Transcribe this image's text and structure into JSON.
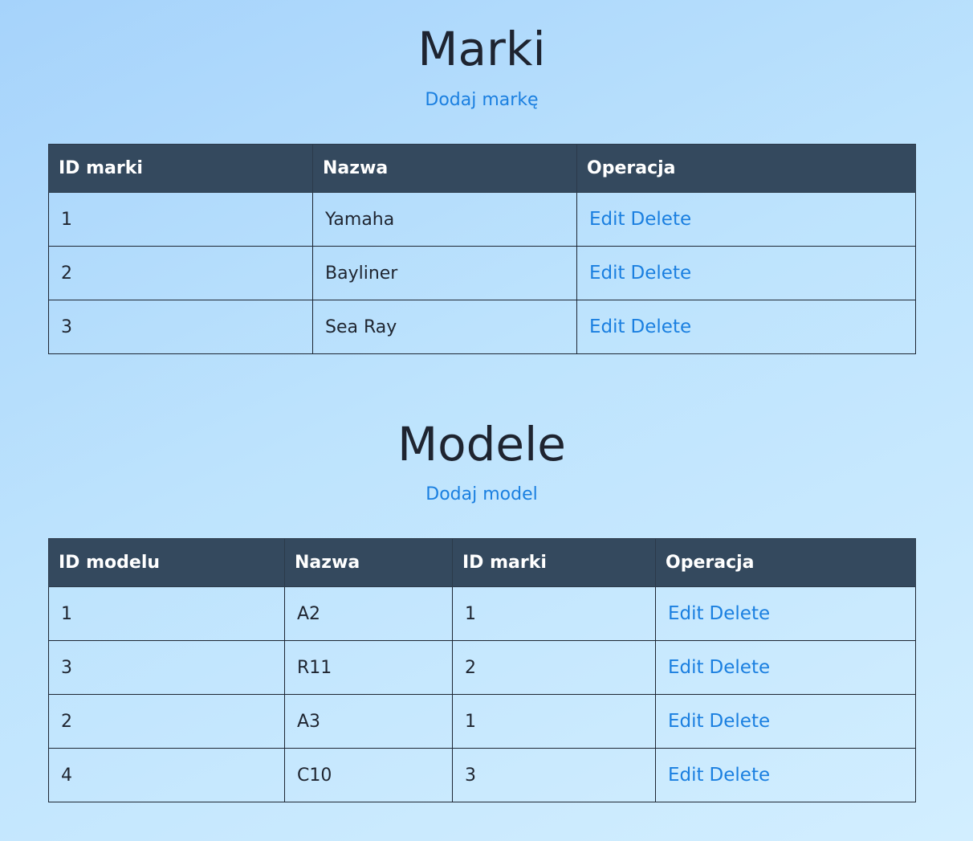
{
  "brands": {
    "title": "Marki",
    "add_label": "Dodaj markę",
    "headers": [
      "ID marki",
      "Nazwa",
      "Operacja"
    ],
    "rows": [
      {
        "id": "1",
        "name": "Yamaha"
      },
      {
        "id": "2",
        "name": "Bayliner"
      },
      {
        "id": "3",
        "name": "Sea Ray"
      }
    ]
  },
  "models": {
    "title": "Modele",
    "add_label": "Dodaj model",
    "headers": [
      "ID modelu",
      "Nazwa",
      "ID marki",
      "Operacja"
    ],
    "rows": [
      {
        "id": "1",
        "name": "A2",
        "brand_id": "1"
      },
      {
        "id": "3",
        "name": "R11",
        "brand_id": "2"
      },
      {
        "id": "2",
        "name": "A3",
        "brand_id": "1"
      },
      {
        "id": "4",
        "name": "C10",
        "brand_id": "3"
      }
    ]
  },
  "actions": {
    "edit_label": "Edit",
    "delete_label": "Delete"
  },
  "colors": {
    "link": "#1a7fe0",
    "header_bg": "#34495e"
  }
}
